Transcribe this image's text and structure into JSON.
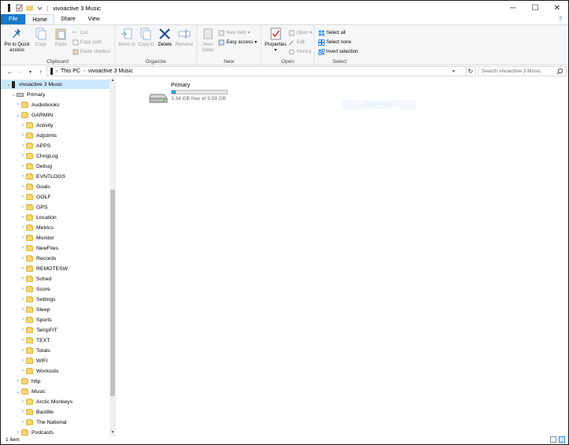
{
  "window": {
    "title": "vivoactive 3 Music",
    "minimize": "─",
    "maximize": "☐",
    "close": "✕"
  },
  "tabs": {
    "file": "File",
    "home": "Home",
    "share": "Share",
    "view": "View",
    "help": "?"
  },
  "ribbon": {
    "clipboard": {
      "label": "Clipboard",
      "pin": "Pin to Quick access",
      "copy": "Copy",
      "paste": "Paste",
      "cut": "Cut",
      "copy_path": "Copy path",
      "paste_shortcut": "Paste shortcut"
    },
    "organize": {
      "label": "Organize",
      "move_to": "Move to",
      "copy_to": "Copy to",
      "delete": "Delete",
      "rename": "Rename"
    },
    "new": {
      "label": "New",
      "new_folder": "New folder",
      "new_item": "New item",
      "easy_access": "Easy access"
    },
    "open": {
      "label": "Open",
      "properties": "Properties",
      "open": "Open",
      "edit": "Edit",
      "history": "History"
    },
    "select": {
      "label": "Select",
      "select_all": "Select all",
      "select_none": "Select none",
      "invert": "Invert selection"
    }
  },
  "address": {
    "crumbs": [
      "This PC",
      "vivoactive 3 Music"
    ],
    "search_placeholder": "Search vivoactive 3 Music"
  },
  "tree": {
    "root": "vivoactive 3 Music",
    "primary": "Primary",
    "garmin": "GARMIN",
    "audiobooks": "Audiobooks",
    "garmin_children": [
      "Activity",
      "Adjstmts",
      "APPS",
      "ChngLog",
      "Debug",
      "EVNTLOGS",
      "Goals",
      "GOLF",
      "GPS",
      "Location",
      "Metrics",
      "Monitor",
      "NewFiles",
      "Records",
      "REMOTESW",
      "Sched",
      "Score",
      "Settings",
      "Sleep",
      "Sports",
      "TempFIT",
      "TEXT",
      "Totals",
      "WIFI",
      "Workouts"
    ],
    "http": "http",
    "music": "Music",
    "music_children": [
      "Arctic Monkeys",
      "Bastille",
      "The National"
    ],
    "podcasts": "Podcasts"
  },
  "content": {
    "drive_name": "Primary",
    "drive_free": "3.34 GB free of 3.59 GB",
    "drive_used_fraction": 0.07,
    "ghost_text": "Restore Files"
  },
  "status": {
    "items": "1 item"
  },
  "colors": {
    "accent": "#1979ca",
    "selection": "#cce8ff",
    "capacity": "#26a0da"
  }
}
